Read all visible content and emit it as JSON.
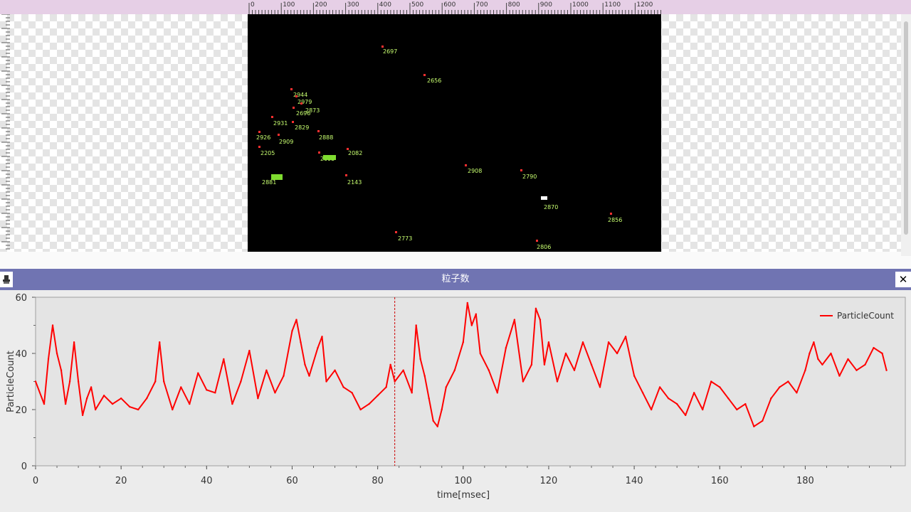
{
  "panel": {
    "title": "粒子数",
    "close_label": "✕",
    "pin_icon": "pin-icon"
  },
  "ruler": {
    "labels": [
      "0",
      "100",
      "200",
      "300",
      "400",
      "500",
      "600",
      "700",
      "800",
      "900",
      "1000",
      "1100",
      "1200"
    ]
  },
  "particles": [
    {
      "id": "2697"
    },
    {
      "id": "2656"
    },
    {
      "id": "2944"
    },
    {
      "id": "2979"
    },
    {
      "id": "2873"
    },
    {
      "id": "2696"
    },
    {
      "id": "2931"
    },
    {
      "id": "2829"
    },
    {
      "id": "2926"
    },
    {
      "id": "2909"
    },
    {
      "id": "2888"
    },
    {
      "id": "2205"
    },
    {
      "id": "2082"
    },
    {
      "id": "2095"
    },
    {
      "id": "2908"
    },
    {
      "id": "2790"
    },
    {
      "id": "2881"
    },
    {
      "id": "2143"
    },
    {
      "id": "2870"
    },
    {
      "id": "2856"
    },
    {
      "id": "2773"
    },
    {
      "id": "2806"
    }
  ],
  "colors": {
    "series": "#ff0000",
    "plot_bg": "#e4e4e4",
    "titlebar": "#7074b2"
  },
  "chart_data": {
    "type": "line",
    "title": "",
    "xlabel": "time[msec]",
    "ylabel": "ParticleCount",
    "xlim": [
      0,
      200
    ],
    "ylim": [
      0,
      60
    ],
    "xticks": [
      0,
      20,
      40,
      60,
      80,
      100,
      120,
      140,
      160,
      180
    ],
    "yticks": [
      0,
      20,
      40,
      60
    ],
    "legend": "top-right",
    "cursor_x": 84,
    "series": [
      {
        "name": "ParticleCount",
        "color": "#ff0000",
        "x": [
          0,
          2,
          3,
          4,
          5,
          6,
          7,
          8,
          9,
          10,
          11,
          12,
          13,
          14,
          16,
          18,
          20,
          22,
          24,
          26,
          28,
          29,
          30,
          32,
          34,
          36,
          38,
          40,
          42,
          44,
          46,
          48,
          50,
          52,
          54,
          56,
          58,
          60,
          61,
          62,
          63,
          64,
          66,
          67,
          68,
          70,
          72,
          74,
          76,
          78,
          80,
          82,
          83,
          84,
          86,
          88,
          89,
          90,
          91,
          92,
          93,
          94,
          95,
          96,
          98,
          100,
          101,
          102,
          103,
          104,
          106,
          108,
          110,
          112,
          114,
          116,
          117,
          118,
          119,
          120,
          122,
          124,
          126,
          128,
          130,
          132,
          134,
          136,
          138,
          140,
          142,
          144,
          146,
          148,
          150,
          152,
          154,
          156,
          158,
          160,
          162,
          164,
          166,
          168,
          170,
          172,
          174,
          176,
          178,
          180,
          181,
          182,
          183,
          184,
          186,
          188,
          190,
          192,
          194,
          196,
          198,
          199
        ],
        "y": [
          30,
          22,
          38,
          50,
          40,
          34,
          22,
          30,
          44,
          30,
          18,
          24,
          28,
          20,
          25,
          22,
          24,
          21,
          20,
          24,
          30,
          44,
          30,
          20,
          28,
          22,
          33,
          27,
          26,
          38,
          22,
          30,
          41,
          24,
          34,
          26,
          32,
          48,
          52,
          44,
          36,
          32,
          42,
          46,
          30,
          34,
          28,
          26,
          20,
          22,
          25,
          28,
          36,
          30,
          34,
          26,
          50,
          38,
          32,
          24,
          16,
          14,
          20,
          28,
          34,
          44,
          58,
          50,
          54,
          40,
          34,
          26,
          42,
          52,
          30,
          36,
          56,
          52,
          36,
          44,
          30,
          40,
          34,
          44,
          36,
          28,
          44,
          40,
          46,
          32,
          26,
          20,
          28,
          24,
          22,
          18,
          26,
          20,
          30,
          28,
          24,
          20,
          22,
          14,
          16,
          24,
          28,
          30,
          26,
          34,
          40,
          44,
          38,
          36,
          40,
          32,
          38,
          34,
          36,
          42,
          40,
          34
        ]
      }
    ]
  }
}
